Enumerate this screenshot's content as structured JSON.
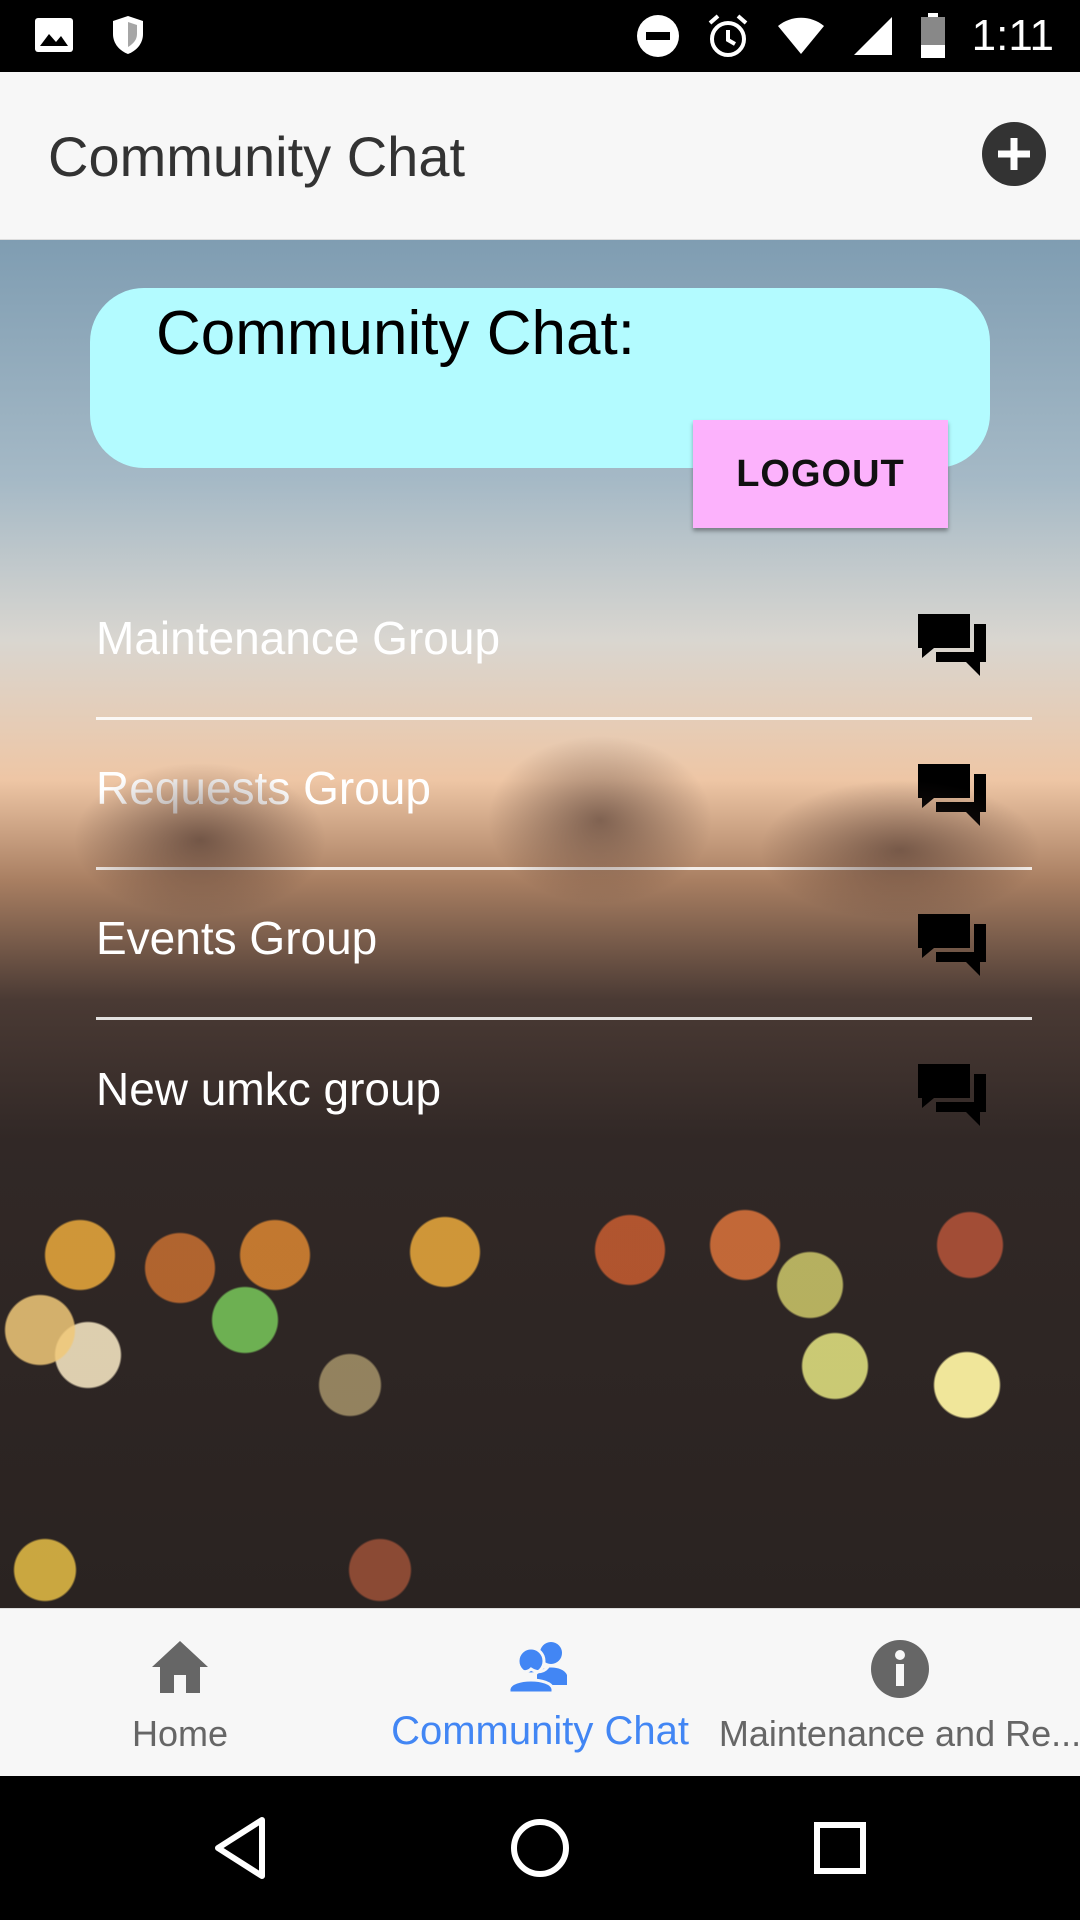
{
  "status_bar": {
    "time": "1:11",
    "icons": [
      "image-icon",
      "shield-icon",
      "do-not-disturb-icon",
      "alarm-icon",
      "wifi-icon",
      "signal-icon",
      "battery-icon"
    ]
  },
  "app_bar": {
    "title": "Community Chat",
    "add_icon": "add-circle-icon"
  },
  "header_card": {
    "title": "Community Chat:",
    "logout_label": "LOGOUT",
    "background": "#b3fbff",
    "button_color": "#fcb2fc"
  },
  "groups": [
    {
      "label": "Maintenance Group",
      "icon": "chat-bubbles-icon"
    },
    {
      "label": "Requests Group",
      "icon": "chat-bubbles-icon"
    },
    {
      "label": "Events Group",
      "icon": "chat-bubbles-icon"
    },
    {
      "label": "New umkc group",
      "icon": "chat-bubbles-icon"
    }
  ],
  "bottom_nav": {
    "items": [
      {
        "label": "Home",
        "icon": "home-icon",
        "active": false
      },
      {
        "label": "Community Chat",
        "icon": "people-icon",
        "active": true
      },
      {
        "label": "Maintenance and Re...",
        "icon": "info-icon",
        "active": false
      }
    ],
    "active_color": "#4286f4"
  },
  "system_nav": [
    "back-icon",
    "home-circle-icon",
    "recents-icon"
  ]
}
